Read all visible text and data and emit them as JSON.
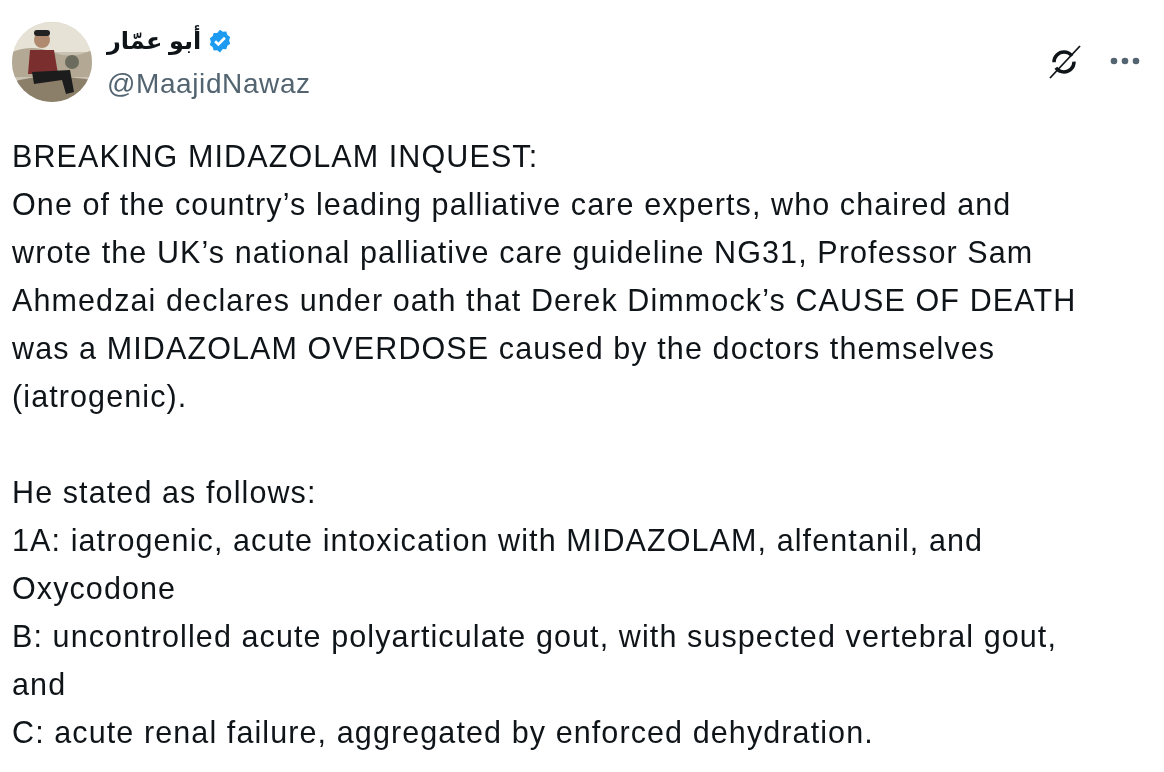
{
  "author": {
    "name": "أبو عمّار",
    "verified": true,
    "handle": "@MaajidNawaz"
  },
  "paragraphs": [
    "BREAKING MIDAZOLAM INQUEST:\nOne of the country’s leading palliative care experts, who chaired and\nwrote the UK’s national palliative care guideline NG31, Professor Sam\nAhmedzai declares under oath that Derek Dimmock’s CAUSE OF DEATH\nwas a MIDAZOLAM OVERDOSE caused by the doctors themselves\n(iatrogenic).",
    "He stated as follows:\n1A: iatrogenic, acute intoxication with MIDAZOLAM, alfentanil, and\nOxycodone\nB: uncontrolled acute polyarticulate gout, with suspected vertebral gout,\nand\nC: acute renal failure, aggregated by enforced dehydration."
  ]
}
